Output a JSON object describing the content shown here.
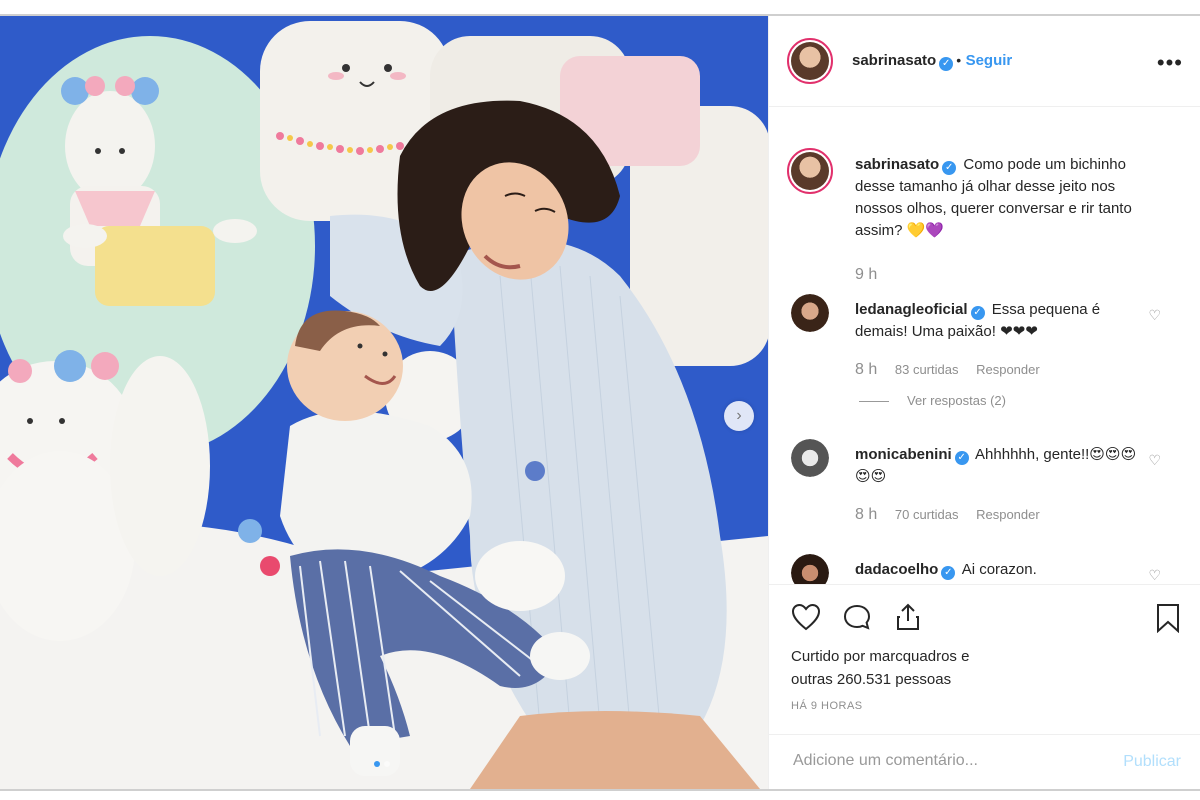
{
  "post": {
    "image_alt_icon": "photo",
    "carousel": {
      "count": 2,
      "active": 0
    },
    "accent_color": "#3897f0"
  },
  "header": {
    "username": "sabrinasato",
    "separator": "•",
    "follow_label": "Seguir",
    "more_label": "•••"
  },
  "caption": {
    "username": "sabrinasato",
    "text": "Como pode um bichinho desse tamanho já olhar desse jeito nos nossos olhos, querer conversar e rir tanto assim? 💛💜",
    "time": "9 h"
  },
  "comments": [
    {
      "username": "ledanagleoficial",
      "text": "Essa pequena é demais! Uma paixão! ❤❤❤",
      "time": "8 h",
      "likes": "83 curtidas",
      "reply_label": "Responder",
      "view_replies": "Ver respostas (2)"
    },
    {
      "username": "monicabenini",
      "text": "Ahhhhhh, gente!!😍😍😍😍😍",
      "time": "8 h",
      "likes": "70 curtidas",
      "reply_label": "Responder"
    },
    {
      "username": "dadacoelho",
      "text": "Ai corazon."
    }
  ],
  "actions": {
    "liked_by_prefix": "Curtido por",
    "liked_by_user": "marcquadros",
    "liked_by_suffix": "e",
    "others": "outras 260.531 pessoas",
    "time_ago": "HÁ 9 HORAS"
  },
  "add_comment": {
    "placeholder": "Adicione um comentário...",
    "publish_label": "Publicar"
  }
}
